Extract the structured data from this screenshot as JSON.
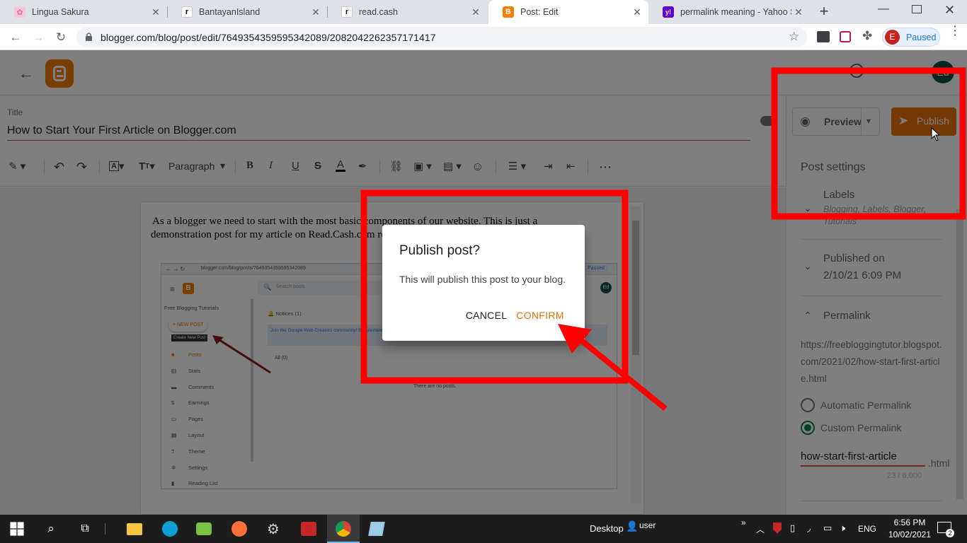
{
  "browser": {
    "tabs": [
      {
        "title": "Lingua Sakura",
        "icon": "flower-icon"
      },
      {
        "title": "BantayanIsland",
        "icon": "r-icon"
      },
      {
        "title": "read.cash",
        "icon": "r-icon"
      },
      {
        "title": "Post: Edit",
        "icon": "blogger-icon",
        "active": true
      },
      {
        "title": "permalink meaning - Yahoo Se",
        "icon": "yahoo-icon"
      }
    ],
    "url": "blogger.com/blog/post/edit/7649354359595342089/2082042262357171417",
    "profile_initial": "E",
    "profile_status": "Paused"
  },
  "blogger": {
    "avatar": "Ed",
    "title_label": "Title",
    "post_title": "How to Start Your First Article on Blogger.com",
    "toolbar": {
      "paragraph": "Paragraph"
    },
    "content_text": "As a blogger we need to start with the most basic components of our website. This is just a demonstration post for my article on Read.Cash.com regarding how to start writing blogger.",
    "preview_label": "Preview",
    "publish_label": "Publish",
    "sidebar": {
      "heading": "Post settings",
      "labels_title": "Labels",
      "labels_value": "Blogging, Labels, Blogger, Tutorials",
      "published_title": "Published on",
      "published_value": "2/10/21 6:09 PM",
      "permalink_title": "Permalink",
      "permalink_url": "https://freebloggingtutor.blogspot.com/2021/02/how-start-first-article.html",
      "automatic_label": "Automatic Permalink",
      "custom_label": "Custom Permalink",
      "custom_value": "how-start-first-article",
      "custom_suffix": ".html",
      "char_count": "23 / 8,000"
    }
  },
  "embedded_screenshot": {
    "url": "blogger.com/blog/posts/7649354359595342089",
    "search_placeholder": "Search posts",
    "profile": "Paused",
    "avatar": "Ed",
    "blog_name": "Free Blogging Tutorials",
    "new_post": "+ NEW POST",
    "tooltip": "Create New Post",
    "nav": [
      "Posts",
      "Stats",
      "Comments",
      "Earnings",
      "Pages",
      "Layout",
      "Theme",
      "Settings",
      "Reading List"
    ],
    "notices": "Notices (1)",
    "notice_text": "Join the Google Web Creators community! Supplement updates from Google via Google Web Creators. Follow",
    "filter": "All (0)",
    "empty": "There are no posts."
  },
  "dialog": {
    "title": "Publish post?",
    "message": "This will publish this post to your blog.",
    "cancel": "CANCEL",
    "confirm": "CONFIRM"
  },
  "taskbar": {
    "desktop_label": "Desktop",
    "user_label": "user",
    "lang": "ENG",
    "time": "6:56 PM",
    "date": "10/02/2021",
    "notif_count": "2"
  },
  "colors": {
    "blogger_orange": "#e8710a",
    "annotation_red": "#ff0000",
    "accent_red": "#dd4b39"
  }
}
